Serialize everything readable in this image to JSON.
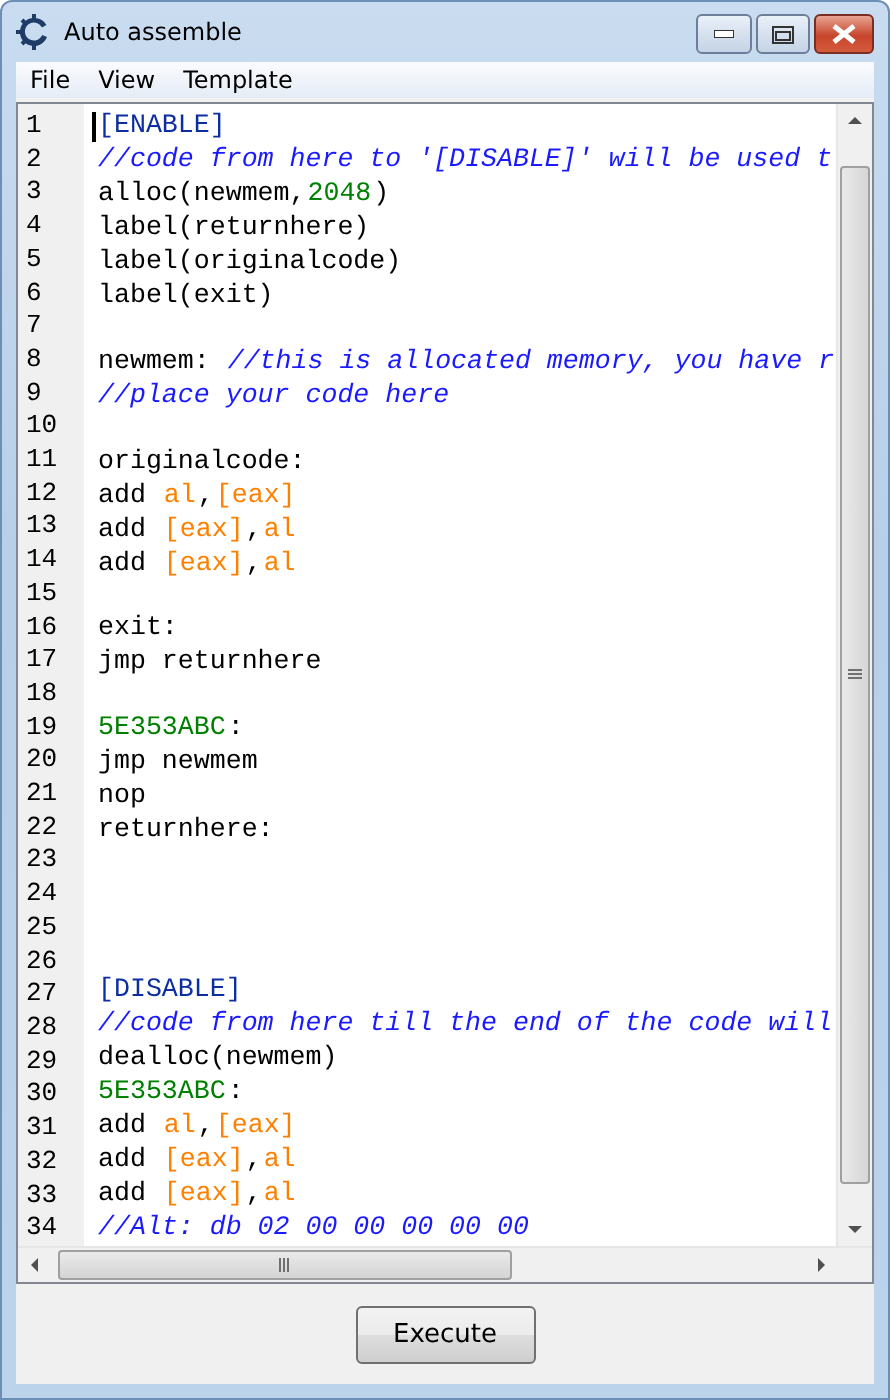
{
  "window": {
    "title": "Auto assemble"
  },
  "menu": [
    "File",
    "View",
    "Template"
  ],
  "editor": {
    "lines": [
      {
        "number": "1",
        "tokens": [
          {
            "kind": "section",
            "text": "[ENABLE]"
          }
        ]
      },
      {
        "number": "2",
        "tokens": [
          {
            "kind": "comment",
            "text": "//code from here to '[DISABLE]' will be used t"
          }
        ]
      },
      {
        "number": "3",
        "tokens": [
          {
            "kind": "plain",
            "text": "alloc(newmem,"
          },
          {
            "kind": "number",
            "text": "2048"
          },
          {
            "kind": "plain",
            "text": ")"
          }
        ]
      },
      {
        "number": "4",
        "tokens": [
          {
            "kind": "plain",
            "text": "label(returnhere)"
          }
        ]
      },
      {
        "number": "5",
        "tokens": [
          {
            "kind": "plain",
            "text": "label(originalcode)"
          }
        ]
      },
      {
        "number": "6",
        "tokens": [
          {
            "kind": "plain",
            "text": "label(exit)"
          }
        ]
      },
      {
        "number": "7"
      },
      {
        "number": "8",
        "tokens": [
          {
            "kind": "plain",
            "text": "newmem: "
          },
          {
            "kind": "comment",
            "text": "//this is allocated memory, you have r"
          }
        ]
      },
      {
        "number": "9",
        "tokens": [
          {
            "kind": "comment",
            "text": "//place your code here"
          }
        ]
      },
      {
        "number": "10"
      },
      {
        "number": "11",
        "tokens": [
          {
            "kind": "plain",
            "text": "originalcode:"
          }
        ]
      },
      {
        "number": "12",
        "tokens": [
          {
            "kind": "plain",
            "text": "add "
          },
          {
            "kind": "register",
            "text": "al"
          },
          {
            "kind": "plain",
            "text": ","
          },
          {
            "kind": "register",
            "text": "[eax]"
          }
        ]
      },
      {
        "number": "13",
        "tokens": [
          {
            "kind": "plain",
            "text": "add "
          },
          {
            "kind": "register",
            "text": "[eax]"
          },
          {
            "kind": "plain",
            "text": ","
          },
          {
            "kind": "register",
            "text": "al"
          }
        ]
      },
      {
        "number": "14",
        "tokens": [
          {
            "kind": "plain",
            "text": "add "
          },
          {
            "kind": "register",
            "text": "[eax]"
          },
          {
            "kind": "plain",
            "text": ","
          },
          {
            "kind": "register",
            "text": "al"
          }
        ]
      },
      {
        "number": "15"
      },
      {
        "number": "16",
        "tokens": [
          {
            "kind": "plain",
            "text": "exit:"
          }
        ]
      },
      {
        "number": "17",
        "tokens": [
          {
            "kind": "plain",
            "text": "jmp returnhere"
          }
        ]
      },
      {
        "number": "18"
      },
      {
        "number": "19",
        "tokens": [
          {
            "kind": "address",
            "text": "5E353ABC"
          },
          {
            "kind": "plain",
            "text": ":"
          }
        ]
      },
      {
        "number": "20",
        "tokens": [
          {
            "kind": "plain",
            "text": "jmp newmem"
          }
        ]
      },
      {
        "number": "21",
        "tokens": [
          {
            "kind": "plain",
            "text": "nop"
          }
        ]
      },
      {
        "number": "22",
        "tokens": [
          {
            "kind": "plain",
            "text": "returnhere:"
          }
        ]
      },
      {
        "number": "23"
      },
      {
        "number": "24"
      },
      {
        "number": "25"
      },
      {
        "number": "26"
      },
      {
        "number": "27",
        "tokens": [
          {
            "kind": "section",
            "text": "[DISABLE]"
          }
        ]
      },
      {
        "number": "28",
        "tokens": [
          {
            "kind": "comment",
            "text": "//code from here till the end of the code will"
          }
        ]
      },
      {
        "number": "29",
        "tokens": [
          {
            "kind": "plain",
            "text": "dealloc(newmem)"
          }
        ]
      },
      {
        "number": "30",
        "tokens": [
          {
            "kind": "address",
            "text": "5E353ABC"
          },
          {
            "kind": "plain",
            "text": ":"
          }
        ]
      },
      {
        "number": "31",
        "tokens": [
          {
            "kind": "plain",
            "text": "add "
          },
          {
            "kind": "register",
            "text": "al"
          },
          {
            "kind": "plain",
            "text": ","
          },
          {
            "kind": "register",
            "text": "[eax]"
          }
        ]
      },
      {
        "number": "32",
        "tokens": [
          {
            "kind": "plain",
            "text": "add "
          },
          {
            "kind": "register",
            "text": "[eax]"
          },
          {
            "kind": "plain",
            "text": ","
          },
          {
            "kind": "register",
            "text": "al"
          }
        ]
      },
      {
        "number": "33",
        "tokens": [
          {
            "kind": "plain",
            "text": "add "
          },
          {
            "kind": "register",
            "text": "[eax]"
          },
          {
            "kind": "plain",
            "text": ","
          },
          {
            "kind": "register",
            "text": "al"
          }
        ]
      },
      {
        "number": "34",
        "tokens": [
          {
            "kind": "comment",
            "text": "//Alt: db 02 00 00 00 00 00"
          }
        ]
      }
    ]
  },
  "buttons": [
    "Execute"
  ]
}
